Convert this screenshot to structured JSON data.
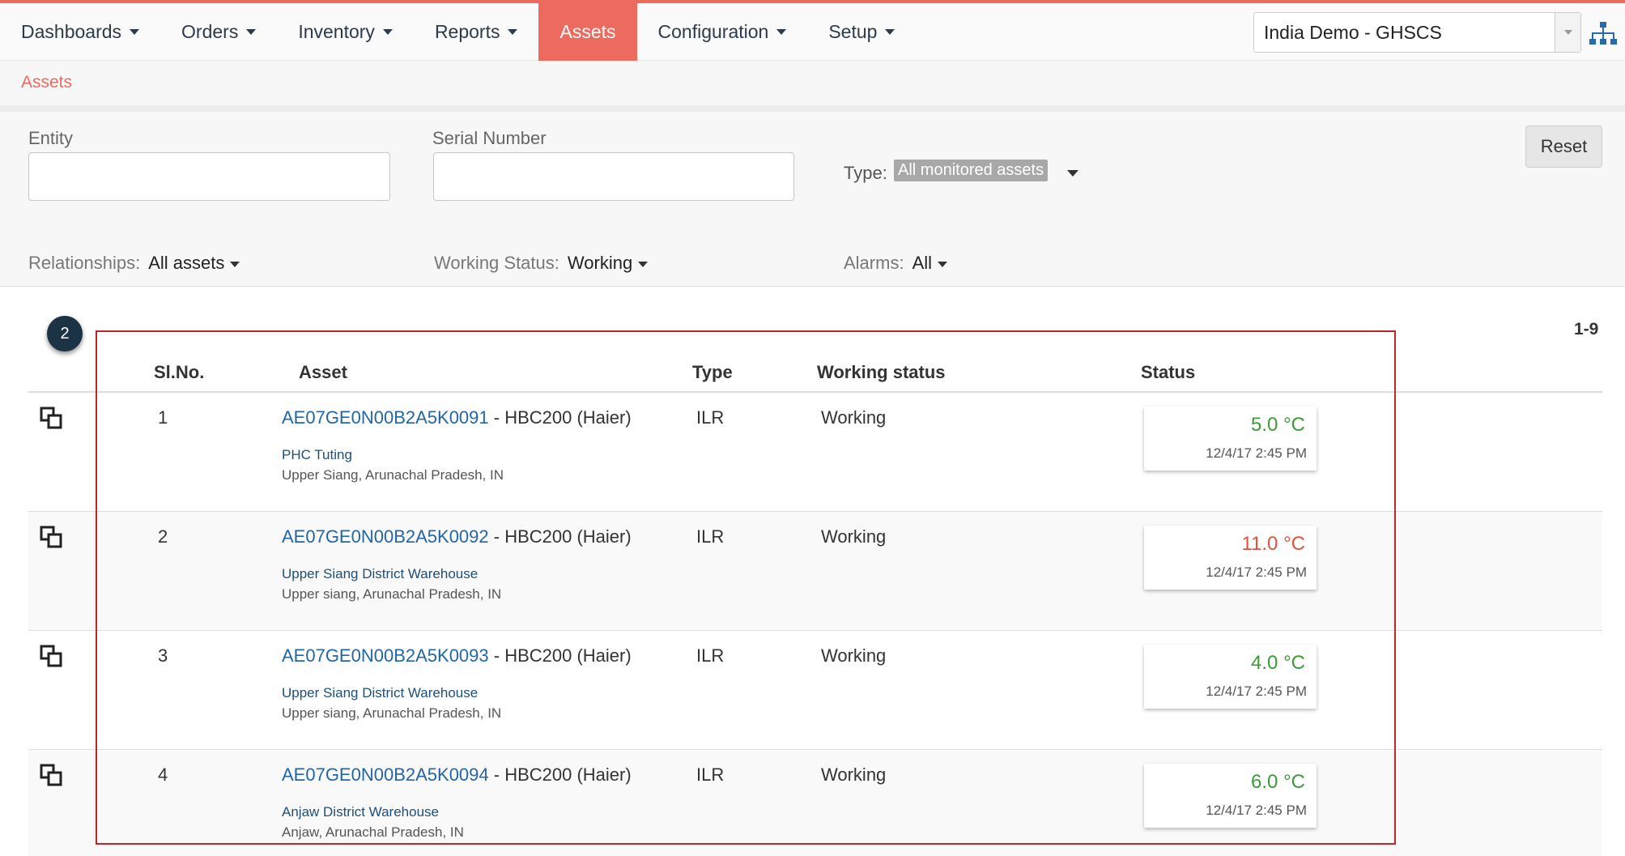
{
  "nav": {
    "items": [
      {
        "label": "Dashboards",
        "dropdown": true,
        "active": false
      },
      {
        "label": "Orders",
        "dropdown": true,
        "active": false
      },
      {
        "label": "Inventory",
        "dropdown": true,
        "active": false
      },
      {
        "label": "Reports",
        "dropdown": true,
        "active": false
      },
      {
        "label": "Assets",
        "dropdown": false,
        "active": true
      },
      {
        "label": "Configuration",
        "dropdown": true,
        "active": false
      },
      {
        "label": "Setup",
        "dropdown": true,
        "active": false
      }
    ],
    "domain": "India Demo - GHSCS",
    "domain_icon": "hierarchy-icon"
  },
  "breadcrumb": {
    "label": "Assets"
  },
  "filters": {
    "entity_label": "Entity",
    "entity_value": "",
    "serial_label": "Serial Number",
    "serial_value": "",
    "type_label": "Type:",
    "type_value": "All monitored assets",
    "reset_label": "Reset",
    "relationships_label": "Relationships:",
    "relationships_value": "All assets",
    "working_status_label": "Working Status:",
    "working_status_value": "Working",
    "alarms_label": "Alarms:",
    "alarms_value": "All"
  },
  "results": {
    "step_badge": "2",
    "range": "1-9",
    "columns": {
      "slno": "Sl.No.",
      "asset": "Asset",
      "type": "Type",
      "working_status": "Working status",
      "status": "Status"
    },
    "rows": [
      {
        "slno": "1",
        "asset_id": "AE07GE0N00B2A5K0091",
        "asset_model": " - HBC200 (Haier)",
        "entity": "PHC Tuting",
        "location": "Upper Siang, Arunachal Pradesh, IN",
        "type": "ILR",
        "working_status": "Working",
        "temp": "5.0 °C",
        "temp_time": "12/4/17 2:45 PM",
        "temp_state": "normal"
      },
      {
        "slno": "2",
        "asset_id": "AE07GE0N00B2A5K0092",
        "asset_model": " - HBC200 (Haier)",
        "entity": "Upper Siang District Warehouse",
        "location": "Upper siang, Arunachal Pradesh, IN",
        "type": "ILR",
        "working_status": "Working",
        "temp": "11.0 °C",
        "temp_time": "12/4/17 2:45 PM",
        "temp_state": "high"
      },
      {
        "slno": "3",
        "asset_id": "AE07GE0N00B2A5K0093",
        "asset_model": " - HBC200 (Haier)",
        "entity": "Upper Siang District Warehouse",
        "location": "Upper siang, Arunachal Pradesh, IN",
        "type": "ILR",
        "working_status": "Working",
        "temp": "4.0 °C",
        "temp_time": "12/4/17 2:45 PM",
        "temp_state": "normal"
      },
      {
        "slno": "4",
        "asset_id": "AE07GE0N00B2A5K0094",
        "asset_model": " - HBC200 (Haier)",
        "entity": "Anjaw District Warehouse",
        "location": "Anjaw, Arunachal Pradesh, IN",
        "type": "ILR",
        "working_status": "Working",
        "temp": "6.0 °C",
        "temp_time": "12/4/17 2:45 PM",
        "temp_state": "normal"
      }
    ]
  },
  "colors": {
    "accent": "#ec6a5e",
    "link": "#2266a8",
    "temp_normal": "#3d9a3a",
    "temp_high": "#e0523f",
    "highlight": "#c0242d"
  }
}
